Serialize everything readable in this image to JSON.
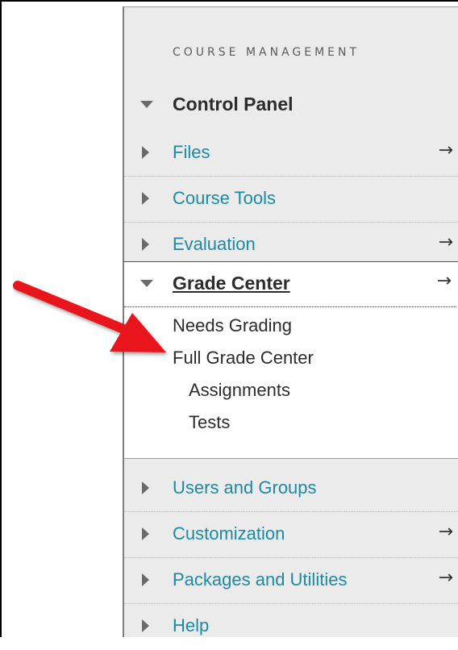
{
  "menu": {
    "section_title": "COURSE MANAGEMENT",
    "control_panel": "Control Panel",
    "items_top": [
      {
        "label": "Files",
        "arrow": "→"
      },
      {
        "label": "Course Tools",
        "arrow": ""
      },
      {
        "label": "Evaluation",
        "arrow": "→"
      }
    ],
    "grade_center": {
      "label": "Grade Center",
      "arrow": "→",
      "children": [
        "Needs Grading",
        "Full Grade Center",
        "Assignments",
        "Tests"
      ]
    },
    "items_bottom": [
      {
        "label": "Users and Groups",
        "arrow": ""
      },
      {
        "label": "Customization",
        "arrow": "→"
      },
      {
        "label": "Packages and Utilities",
        "arrow": "→"
      },
      {
        "label": "Help",
        "arrow": ""
      }
    ]
  },
  "colors": {
    "link": "#1b8aa6",
    "panel_bg": "#ebebeb",
    "annotation_arrow": "#e8141b"
  }
}
